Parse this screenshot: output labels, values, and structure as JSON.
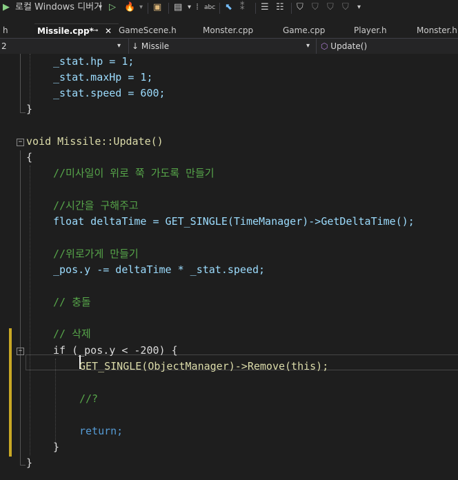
{
  "toolbar": {
    "run_label": "로컬 Windows 디버거",
    "run_dropdown": "▾"
  },
  "tabs": [
    {
      "label": "h"
    },
    {
      "label": "Missile.cpp*"
    },
    {
      "label": "GameScene.h"
    },
    {
      "label": "Monster.cpp"
    },
    {
      "label": "Game.cpp"
    },
    {
      "label": "Player.h"
    },
    {
      "label": "Monster.h"
    }
  ],
  "navbar": {
    "project": "2",
    "scope": "Missile",
    "member": "Update()"
  },
  "code_lines": [
    "_stat.hp = 1;",
    "_stat.maxHp = 1;",
    "_stat.speed = 600;",
    "}",
    "void Missile::Update()",
    "{",
    "//미사일이 위로 쭉 가도록 만들기",
    "//시간을 구해주고",
    "float deltaTime = GET_SINGLE(TimeManager)->GetDeltaTime();",
    "//위로가게 만들기",
    "_pos.y -= deltaTime * _stat.speed;",
    "// 충돌",
    "// 삭제",
    "if (_pos.y < -200) {",
    "GET_SINGLE(ObjectManager)->Remove(this);",
    "//?",
    "return;",
    "}",
    "}"
  ]
}
